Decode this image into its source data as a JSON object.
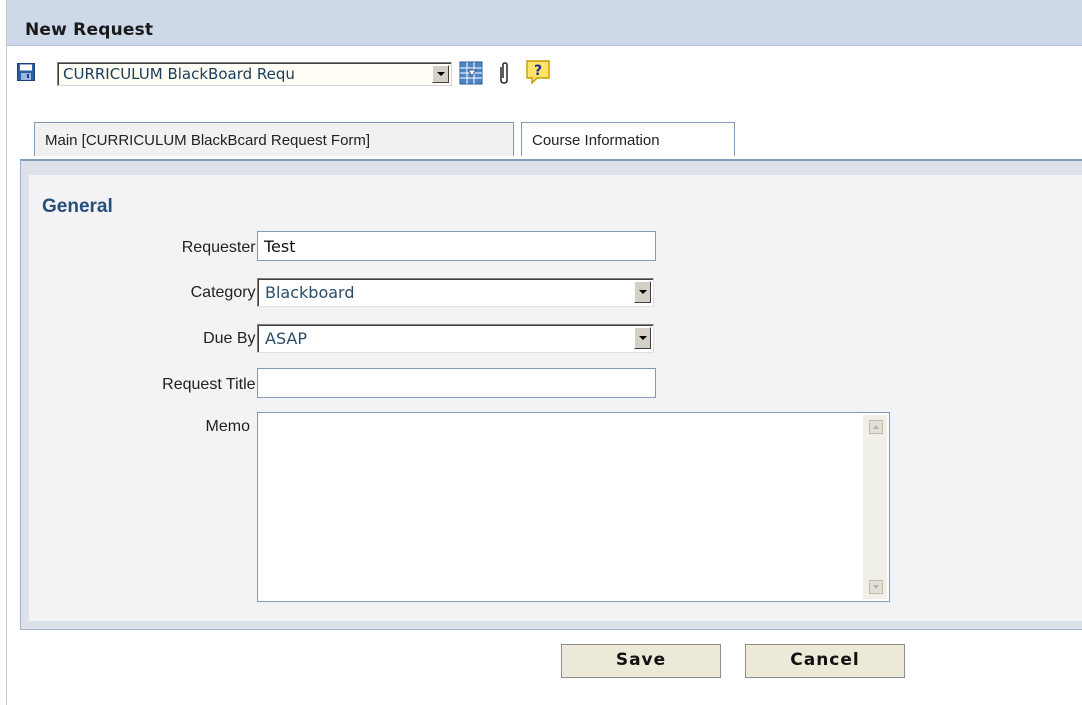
{
  "window": {
    "title": "New Request"
  },
  "toolbar": {
    "template_select_value": "CURRICULUM BlackBoard Requ",
    "icons": [
      "save-icon",
      "grid-form-icon",
      "paperclip-icon",
      "help-icon"
    ]
  },
  "tabs": [
    {
      "label": "Main [CURRICULUM BlackBcard Request Form]",
      "active": true
    },
    {
      "label": "Course Information",
      "active": false
    }
  ],
  "form": {
    "section_title": "General",
    "requester": {
      "label": "Requester:",
      "value": "Test"
    },
    "category": {
      "label": "Category:",
      "value": "Blackboard"
    },
    "due_by": {
      "label": "Due By:",
      "value": "ASAP"
    },
    "request_title": {
      "label": "Request Title:",
      "value": ""
    },
    "memo": {
      "label": "Memo",
      "value": ""
    }
  },
  "buttons": {
    "save_label": "Save",
    "cancel_label": "Cancel"
  },
  "colors": {
    "titlebar": "#cdd8e8",
    "section_title": "#274e78",
    "panel_border": "#7f9db9",
    "button_face": "#ece9d8"
  }
}
